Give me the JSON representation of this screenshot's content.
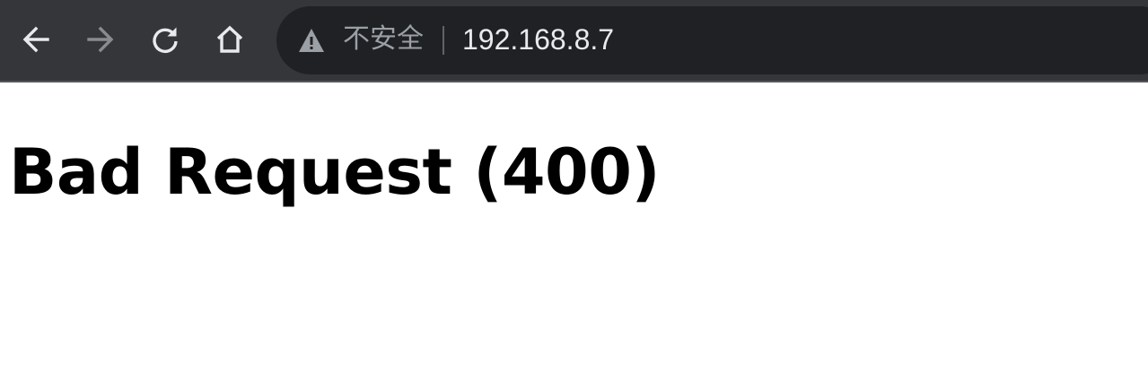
{
  "browser": {
    "nav": {
      "back_icon": "arrow-left-icon",
      "forward_icon": "arrow-right-icon",
      "reload_icon": "reload-icon",
      "home_icon": "home-icon"
    },
    "omnibox": {
      "security_icon": "warning-triangle-icon",
      "security_label": "不安全",
      "url": "192.168.8.7"
    },
    "colors": {
      "toolbar_bg": "#35363a",
      "omnibox_bg": "#202124",
      "icon_active": "#e8eaed",
      "icon_disabled": "#8a8b8f",
      "security_text": "#9aa0a6"
    }
  },
  "page": {
    "title": "Bad Request (400)"
  }
}
